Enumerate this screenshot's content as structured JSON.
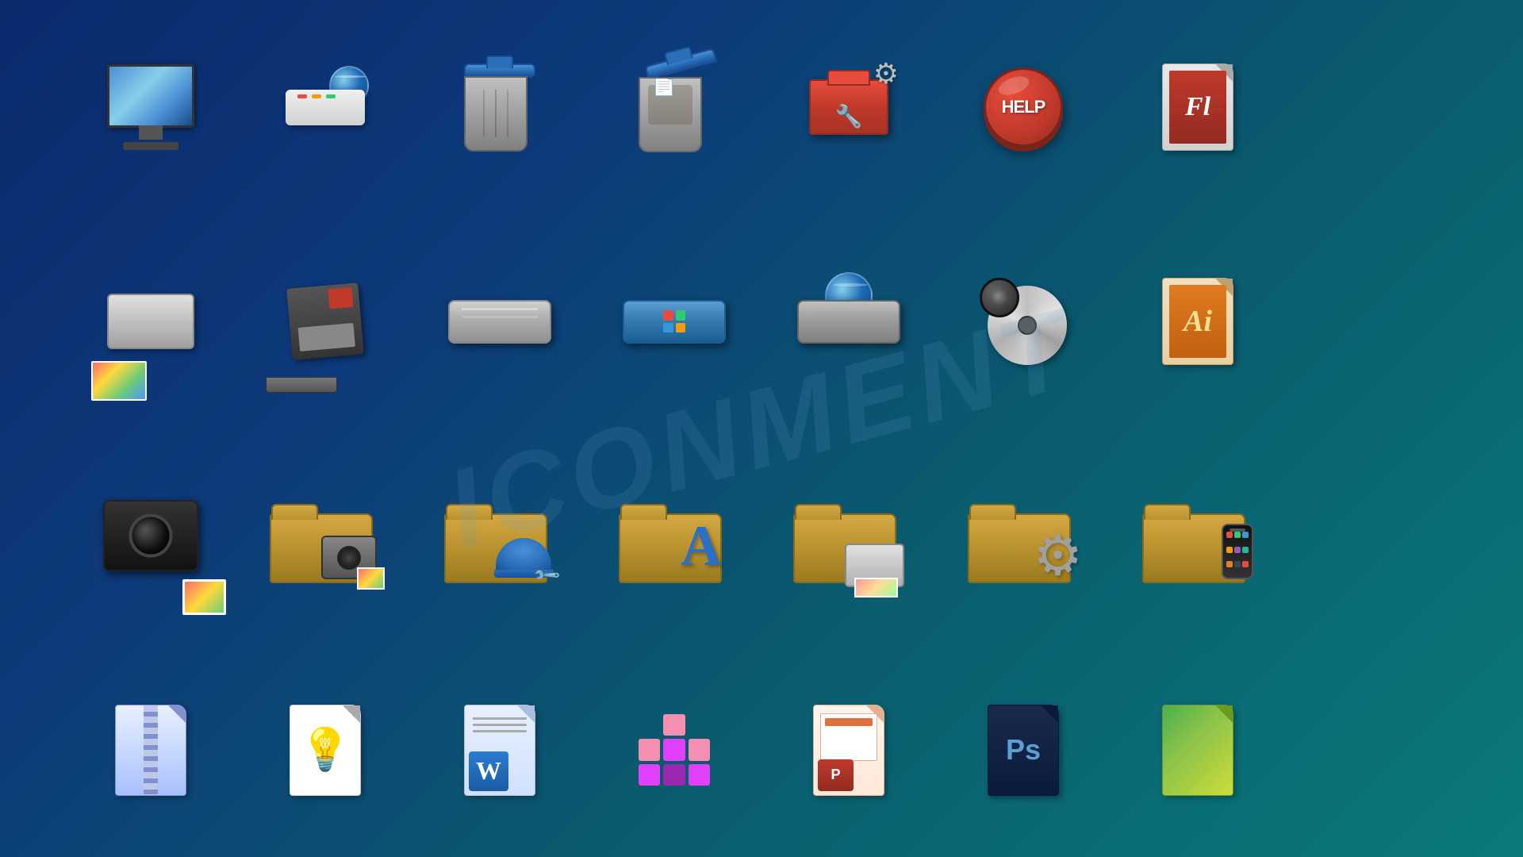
{
  "watermark": "ICONMENT",
  "icons": {
    "row1": [
      {
        "id": "monitor",
        "label": "Computer Monitor"
      },
      {
        "id": "router",
        "label": "Router with Globe"
      },
      {
        "id": "trash-empty",
        "label": "Recycle Bin Empty"
      },
      {
        "id": "trash-full",
        "label": "Recycle Bin Full"
      },
      {
        "id": "toolbox",
        "label": "Toolbox"
      },
      {
        "id": "help",
        "label": "Help Button"
      },
      {
        "id": "flash",
        "label": "Adobe Flash"
      },
      {
        "id": "blank",
        "label": ""
      }
    ],
    "row2": [
      {
        "id": "printer",
        "label": "Printer"
      },
      {
        "id": "floppy",
        "label": "Floppy Disk"
      },
      {
        "id": "hd-silver",
        "label": "Hard Drive Silver"
      },
      {
        "id": "hd-blue",
        "label": "Hard Drive Windows"
      },
      {
        "id": "hd-globe",
        "label": "Hard Drive Globe"
      },
      {
        "id": "cd",
        "label": "CD Speaker"
      },
      {
        "id": "ai",
        "label": "Adobe Illustrator"
      },
      {
        "id": "blank2",
        "label": ""
      }
    ],
    "row3": [
      {
        "id": "camera-black",
        "label": "Camera Black"
      },
      {
        "id": "folder-camera",
        "label": "Folder Camera"
      },
      {
        "id": "folder-hardhat",
        "label": "Folder Hard Hat"
      },
      {
        "id": "folder-font",
        "label": "Folder Font"
      },
      {
        "id": "folder-printer",
        "label": "Folder Printer"
      },
      {
        "id": "folder-gear",
        "label": "Folder Gear"
      },
      {
        "id": "folder-phone",
        "label": "Folder Phone"
      },
      {
        "id": "blank3",
        "label": ""
      }
    ],
    "row4": [
      {
        "id": "zip",
        "label": "ZIP Archive"
      },
      {
        "id": "idea",
        "label": "Idea Template"
      },
      {
        "id": "word",
        "label": "Word Document"
      },
      {
        "id": "blocks3d",
        "label": "3D Blocks"
      },
      {
        "id": "ppt",
        "label": "PowerPoint"
      },
      {
        "id": "ps",
        "label": "Photoshop"
      },
      {
        "id": "image",
        "label": "Image File"
      },
      {
        "id": "blank4",
        "label": ""
      }
    ]
  },
  "flash_label": "Fl",
  "ai_label": "Ai",
  "ps_label": "Ps"
}
